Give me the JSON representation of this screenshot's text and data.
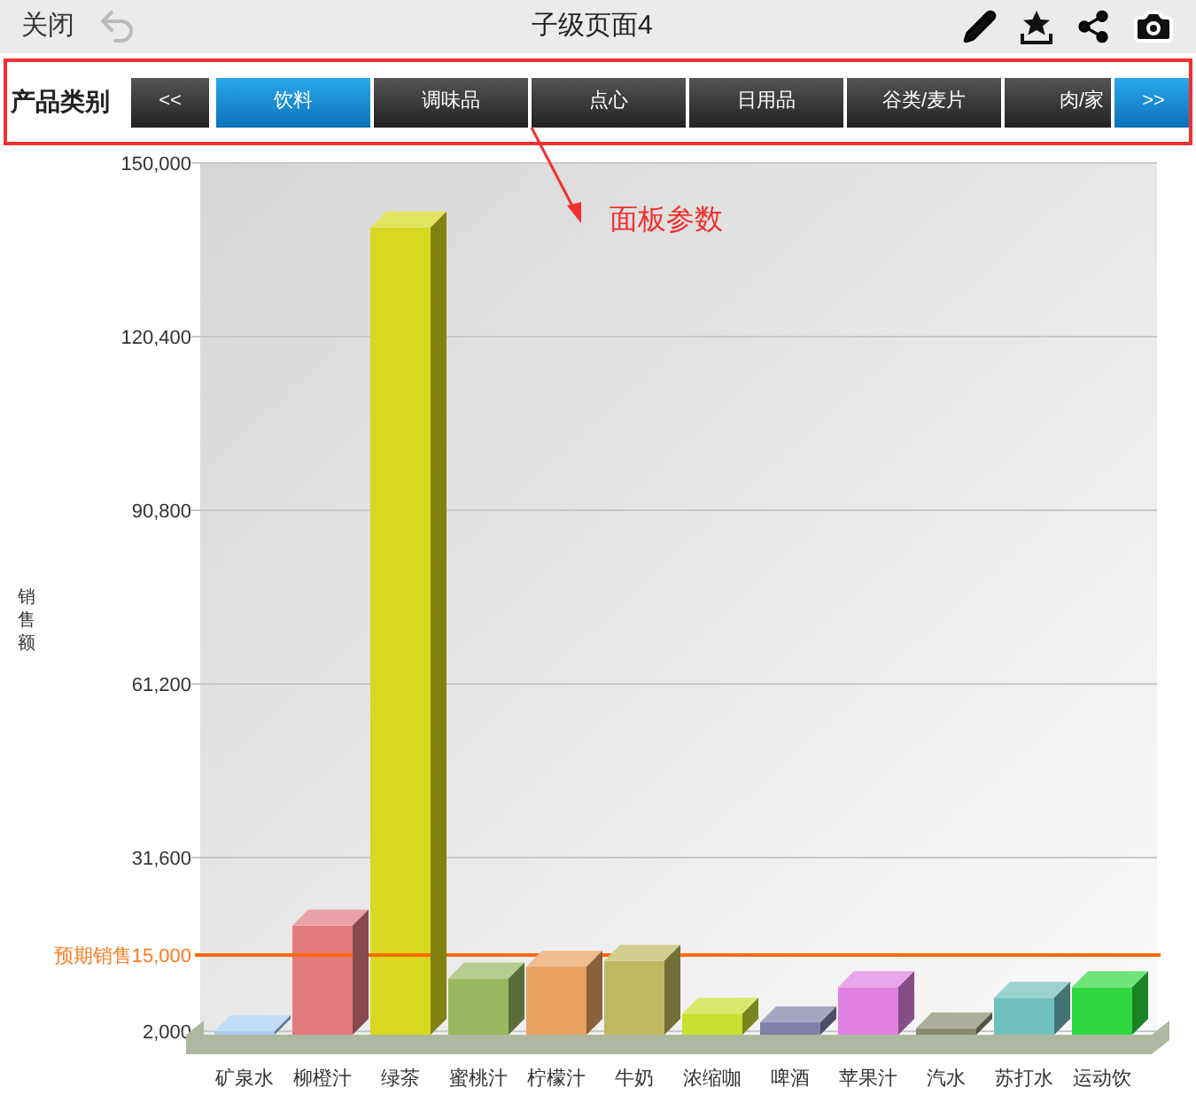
{
  "top_bar": {
    "close": "关闭",
    "title": "子级页面4"
  },
  "filter": {
    "label": "产品类别",
    "prev": "<<",
    "next": ">>",
    "tabs": [
      {
        "label": "饮料",
        "selected": true
      },
      {
        "label": "调味品",
        "selected": false
      },
      {
        "label": "点心",
        "selected": false
      },
      {
        "label": "日用品",
        "selected": false
      },
      {
        "label": "谷类/麦片",
        "selected": false
      },
      {
        "label": "肉/家",
        "selected": false
      }
    ]
  },
  "annotation": {
    "label": "面板参数"
  },
  "chart": {
    "chart_data": {
      "type": "bar",
      "ylabel": "销售额",
      "categories": [
        "矿泉水",
        "柳橙汁",
        "绿茶",
        "蜜桃汁",
        "柠檬汁",
        "牛奶",
        "浓缩咖",
        "啤酒",
        "苹果汁",
        "汽水",
        "苏打水",
        "运动饮"
      ],
      "grid": true,
      "series": [
        {
          "values": [
            2000,
            20000,
            139000,
            11000,
            13000,
            14000,
            5000,
            3500,
            9500,
            2500,
            7700,
            9500
          ]
        }
      ],
      "colors": [
        "#a8cdf0",
        "#e07a7e",
        "#d8d820",
        "#98b860",
        "#e8a060",
        "#c0b860",
        "#c8e030",
        "#8080a8",
        "#e080e0",
        "#8a8a70",
        "#70c0c0",
        "#30d840"
      ],
      "ylim": [
        2000,
        150000
      ],
      "yticks": [
        {
          "value": 2000,
          "label": "2,000"
        },
        {
          "value": 31600,
          "label": "31,600"
        },
        {
          "value": 61200,
          "label": "61,200"
        },
        {
          "value": 90800,
          "label": "90,800"
        },
        {
          "value": 120400,
          "label": "120,400"
        },
        {
          "value": 150000,
          "label": "150,000"
        }
      ],
      "ref_lines": [
        {
          "axis": "y",
          "value": 15000,
          "label": "预期销售15,000"
        }
      ]
    }
  }
}
